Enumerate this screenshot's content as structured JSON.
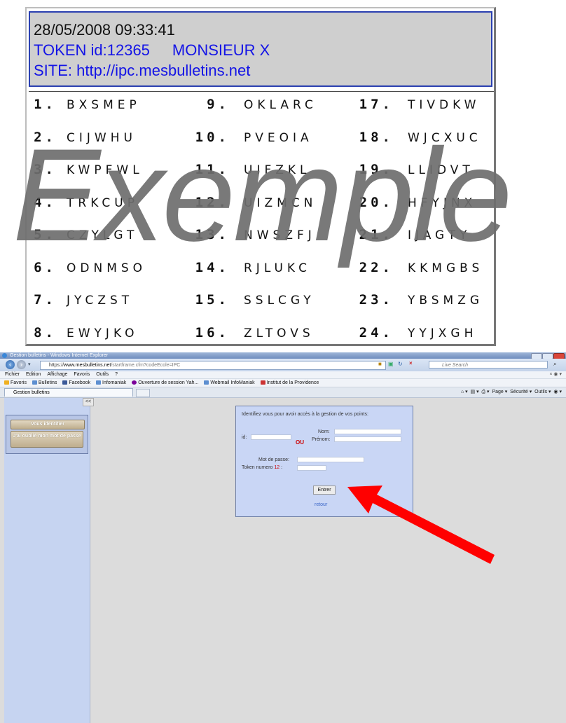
{
  "card": {
    "datetime": "28/05/2008 09:33:41",
    "token_id": "TOKEN id:12365",
    "owner": "MONSIEUR X",
    "site": "SITE: http://ipc.mesbulletins.net",
    "tokens": [
      {
        "n": "1.",
        "c": "BXSMEP"
      },
      {
        "n": "9.",
        "c": "OKLARC"
      },
      {
        "n": "17.",
        "c": "TIVDKW"
      },
      {
        "n": "2.",
        "c": "CIJWHU"
      },
      {
        "n": "10.",
        "c": "PVEOIA"
      },
      {
        "n": "18.",
        "c": "WJCXUC"
      },
      {
        "n": "3.",
        "c": "KWPFWL"
      },
      {
        "n": "11.",
        "c": "UIFZKL"
      },
      {
        "n": "19.",
        "c": "LLIDVT"
      },
      {
        "n": "4.",
        "c": "TRKCUP"
      },
      {
        "n": "12.",
        "c": "UIZMCN"
      },
      {
        "n": "20.",
        "c": "HFYJNX"
      },
      {
        "n": "5.",
        "c": "CZYLGT"
      },
      {
        "n": "13.",
        "c": "NWSZFJ"
      },
      {
        "n": "21.",
        "c": "IJAGTY"
      },
      {
        "n": "6.",
        "c": "ODNMSO"
      },
      {
        "n": "14.",
        "c": "RJLUKC"
      },
      {
        "n": "22.",
        "c": "KKMGBS"
      },
      {
        "n": "7.",
        "c": "JYCZST"
      },
      {
        "n": "15.",
        "c": "SSLCGY"
      },
      {
        "n": "23.",
        "c": "YBSMZG"
      },
      {
        "n": "8.",
        "c": "EWYJKO"
      },
      {
        "n": "16.",
        "c": "ZLTOVS"
      },
      {
        "n": "24.",
        "c": "YYJXGH"
      }
    ]
  },
  "watermark": "Exemple",
  "browser": {
    "title": "Gestion bulletins - Windows Internet Explorer",
    "url_scheme": "https://",
    "url_domain": "www.mesbulletins.net",
    "url_rest": "/startframe.cfm?codeEcole=IPC",
    "search_placeholder": "Live Search",
    "menu": [
      "Fichier",
      "Edition",
      "Affichage",
      "Favoris",
      "Outils",
      "?"
    ],
    "favorites_label": "Favoris",
    "favorites": [
      "Bulletins",
      "Facebook",
      "Infomaniak",
      "Ouverture de session Yah...",
      "Webmail InfoManiak",
      "Institut de la Providence"
    ],
    "tab_label": "Gestion bulletins",
    "commands": [
      "Page ▾",
      "Sécurité ▾",
      "Outils ▾"
    ]
  },
  "page": {
    "collapse_label": "<<",
    "identify_button": "Vous identifier",
    "forgot_button": "J'ai oublié mon mot de passe",
    "login_title": "Identifiez vous pour avoir accès à la gestion de vos points:",
    "id_label": "id:",
    "or_label": "OU",
    "lastname_label": "Nom:",
    "firstname_label": "Prénom:",
    "password_label": "Mot de passe:",
    "token_label": "Token numero",
    "token_number": "12",
    "token_colon": ":",
    "enter_button": "Entrer",
    "back_link": "retour"
  },
  "colors": {
    "arrow": "#ff0000",
    "header_blue": "#1414e6",
    "login_bg": "#c9d6f5"
  }
}
